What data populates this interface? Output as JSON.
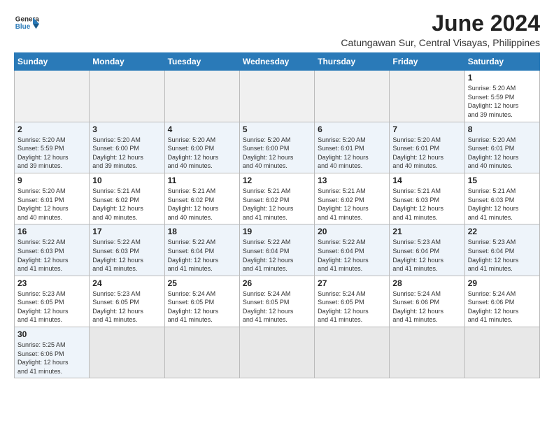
{
  "logo": {
    "text_general": "General",
    "text_blue": "Blue"
  },
  "title": "June 2024",
  "subtitle": "Catungawan Sur, Central Visayas, Philippines",
  "days_of_week": [
    "Sunday",
    "Monday",
    "Tuesday",
    "Wednesday",
    "Thursday",
    "Friday",
    "Saturday"
  ],
  "weeks": [
    {
      "alt": false,
      "days": [
        {
          "num": "",
          "info": "",
          "empty": true
        },
        {
          "num": "",
          "info": "",
          "empty": true
        },
        {
          "num": "",
          "info": "",
          "empty": true
        },
        {
          "num": "",
          "info": "",
          "empty": true
        },
        {
          "num": "",
          "info": "",
          "empty": true
        },
        {
          "num": "",
          "info": "",
          "empty": true
        },
        {
          "num": "1",
          "info": "Sunrise: 5:20 AM\nSunset: 5:59 PM\nDaylight: 12 hours\nand 39 minutes.",
          "empty": false
        }
      ]
    },
    {
      "alt": true,
      "days": [
        {
          "num": "2",
          "info": "Sunrise: 5:20 AM\nSunset: 5:59 PM\nDaylight: 12 hours\nand 39 minutes.",
          "empty": false
        },
        {
          "num": "3",
          "info": "Sunrise: 5:20 AM\nSunset: 6:00 PM\nDaylight: 12 hours\nand 39 minutes.",
          "empty": false
        },
        {
          "num": "4",
          "info": "Sunrise: 5:20 AM\nSunset: 6:00 PM\nDaylight: 12 hours\nand 40 minutes.",
          "empty": false
        },
        {
          "num": "5",
          "info": "Sunrise: 5:20 AM\nSunset: 6:00 PM\nDaylight: 12 hours\nand 40 minutes.",
          "empty": false
        },
        {
          "num": "6",
          "info": "Sunrise: 5:20 AM\nSunset: 6:01 PM\nDaylight: 12 hours\nand 40 minutes.",
          "empty": false
        },
        {
          "num": "7",
          "info": "Sunrise: 5:20 AM\nSunset: 6:01 PM\nDaylight: 12 hours\nand 40 minutes.",
          "empty": false
        },
        {
          "num": "8",
          "info": "Sunrise: 5:20 AM\nSunset: 6:01 PM\nDaylight: 12 hours\nand 40 minutes.",
          "empty": false
        }
      ]
    },
    {
      "alt": false,
      "days": [
        {
          "num": "9",
          "info": "Sunrise: 5:20 AM\nSunset: 6:01 PM\nDaylight: 12 hours\nand 40 minutes.",
          "empty": false
        },
        {
          "num": "10",
          "info": "Sunrise: 5:21 AM\nSunset: 6:02 PM\nDaylight: 12 hours\nand 40 minutes.",
          "empty": false
        },
        {
          "num": "11",
          "info": "Sunrise: 5:21 AM\nSunset: 6:02 PM\nDaylight: 12 hours\nand 40 minutes.",
          "empty": false
        },
        {
          "num": "12",
          "info": "Sunrise: 5:21 AM\nSunset: 6:02 PM\nDaylight: 12 hours\nand 41 minutes.",
          "empty": false
        },
        {
          "num": "13",
          "info": "Sunrise: 5:21 AM\nSunset: 6:02 PM\nDaylight: 12 hours\nand 41 minutes.",
          "empty": false
        },
        {
          "num": "14",
          "info": "Sunrise: 5:21 AM\nSunset: 6:03 PM\nDaylight: 12 hours\nand 41 minutes.",
          "empty": false
        },
        {
          "num": "15",
          "info": "Sunrise: 5:21 AM\nSunset: 6:03 PM\nDaylight: 12 hours\nand 41 minutes.",
          "empty": false
        }
      ]
    },
    {
      "alt": true,
      "days": [
        {
          "num": "16",
          "info": "Sunrise: 5:22 AM\nSunset: 6:03 PM\nDaylight: 12 hours\nand 41 minutes.",
          "empty": false
        },
        {
          "num": "17",
          "info": "Sunrise: 5:22 AM\nSunset: 6:03 PM\nDaylight: 12 hours\nand 41 minutes.",
          "empty": false
        },
        {
          "num": "18",
          "info": "Sunrise: 5:22 AM\nSunset: 6:04 PM\nDaylight: 12 hours\nand 41 minutes.",
          "empty": false
        },
        {
          "num": "19",
          "info": "Sunrise: 5:22 AM\nSunset: 6:04 PM\nDaylight: 12 hours\nand 41 minutes.",
          "empty": false
        },
        {
          "num": "20",
          "info": "Sunrise: 5:22 AM\nSunset: 6:04 PM\nDaylight: 12 hours\nand 41 minutes.",
          "empty": false
        },
        {
          "num": "21",
          "info": "Sunrise: 5:23 AM\nSunset: 6:04 PM\nDaylight: 12 hours\nand 41 minutes.",
          "empty": false
        },
        {
          "num": "22",
          "info": "Sunrise: 5:23 AM\nSunset: 6:04 PM\nDaylight: 12 hours\nand 41 minutes.",
          "empty": false
        }
      ]
    },
    {
      "alt": false,
      "days": [
        {
          "num": "23",
          "info": "Sunrise: 5:23 AM\nSunset: 6:05 PM\nDaylight: 12 hours\nand 41 minutes.",
          "empty": false
        },
        {
          "num": "24",
          "info": "Sunrise: 5:23 AM\nSunset: 6:05 PM\nDaylight: 12 hours\nand 41 minutes.",
          "empty": false
        },
        {
          "num": "25",
          "info": "Sunrise: 5:24 AM\nSunset: 6:05 PM\nDaylight: 12 hours\nand 41 minutes.",
          "empty": false
        },
        {
          "num": "26",
          "info": "Sunrise: 5:24 AM\nSunset: 6:05 PM\nDaylight: 12 hours\nand 41 minutes.",
          "empty": false
        },
        {
          "num": "27",
          "info": "Sunrise: 5:24 AM\nSunset: 6:05 PM\nDaylight: 12 hours\nand 41 minutes.",
          "empty": false
        },
        {
          "num": "28",
          "info": "Sunrise: 5:24 AM\nSunset: 6:06 PM\nDaylight: 12 hours\nand 41 minutes.",
          "empty": false
        },
        {
          "num": "29",
          "info": "Sunrise: 5:24 AM\nSunset: 6:06 PM\nDaylight: 12 hours\nand 41 minutes.",
          "empty": false
        }
      ]
    },
    {
      "alt": true,
      "last": true,
      "days": [
        {
          "num": "30",
          "info": "Sunrise: 5:25 AM\nSunset: 6:06 PM\nDaylight: 12 hours\nand 41 minutes.",
          "empty": false
        },
        {
          "num": "",
          "info": "",
          "empty": true
        },
        {
          "num": "",
          "info": "",
          "empty": true
        },
        {
          "num": "",
          "info": "",
          "empty": true
        },
        {
          "num": "",
          "info": "",
          "empty": true
        },
        {
          "num": "",
          "info": "",
          "empty": true
        },
        {
          "num": "",
          "info": "",
          "empty": true
        }
      ]
    }
  ]
}
